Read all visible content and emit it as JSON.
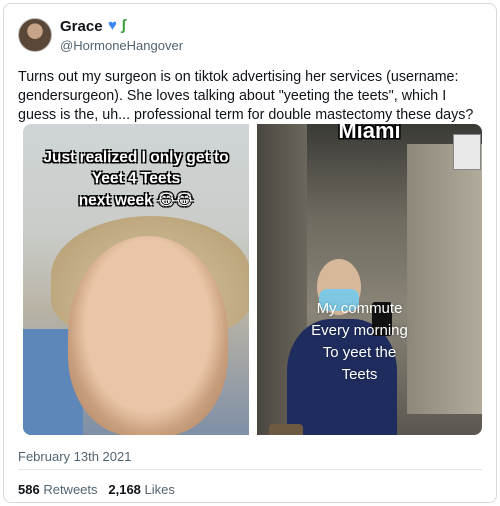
{
  "user": {
    "name": "Grace",
    "name_icons": "💙 🦎",
    "handle": "@HormoneHangover"
  },
  "tweet": {
    "text": "Turns out my surgeon is on tiktok advertising her services (username: gendersurgeon). She loves talking about \"yeeting the teets\", which I guess is the, uh... professional term for double mastectomy these days?",
    "date": "February 13th 2021",
    "retweets": "586",
    "retweets_label": "Retweets",
    "likes": "2,168",
    "likes_label": "Likes"
  },
  "media": {
    "left_caption": [
      "Just realized I only get to",
      "Yeet 4 Teets",
      "next week 😂😂"
    ],
    "right_title": "Miami",
    "right_caption": [
      "My commute",
      "Every morning",
      "To yeet the",
      "Teets"
    ]
  },
  "colors": {
    "heart": "#3b86f0",
    "lizard": "#3aa13a",
    "secondary_text": "#536471"
  }
}
